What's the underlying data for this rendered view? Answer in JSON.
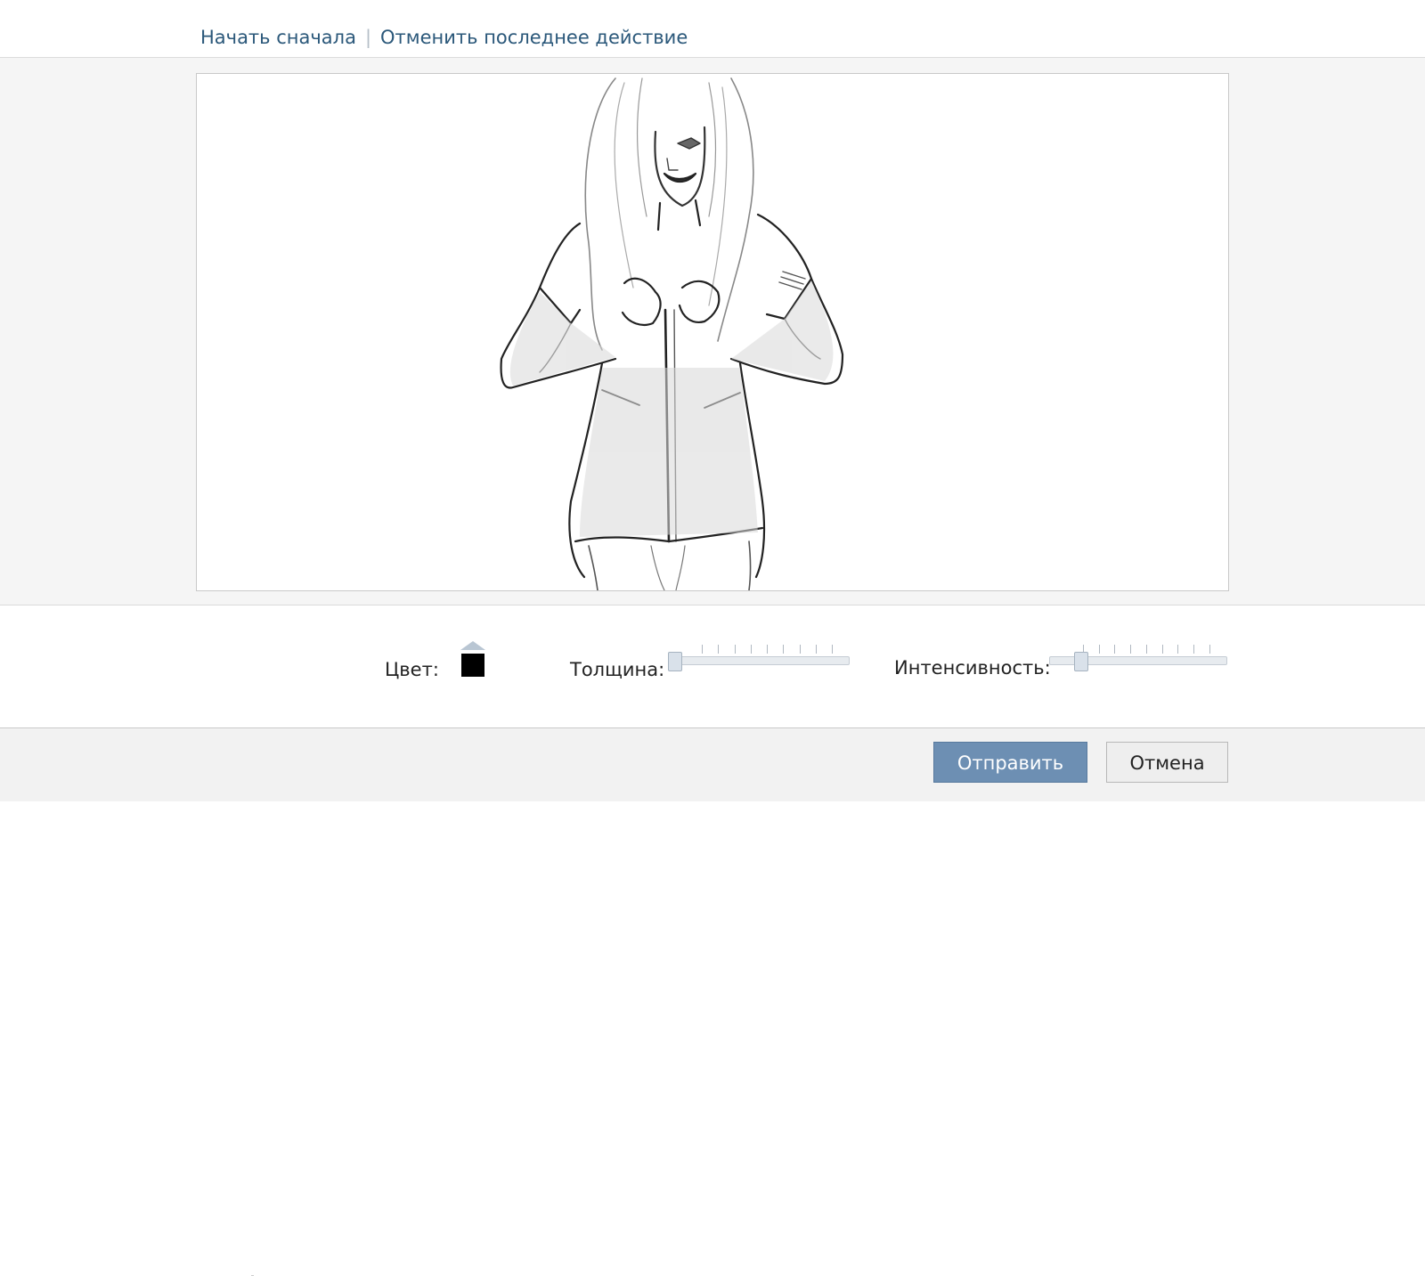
{
  "header": {
    "restart_link": "Начать сначала",
    "undo_link": "Отменить последнее действие"
  },
  "canvas": {
    "subject_icon": "sketch-drawing"
  },
  "toolbar": {
    "color_label": "Цвет:",
    "current_color": "#000000",
    "thickness_label": "Толщина:",
    "thickness_value": 0.0,
    "intensity_label": "Интенсивность:",
    "intensity_value": 0.15
  },
  "footer": {
    "send_label": "Отправить",
    "cancel_label": "Отмена"
  },
  "colors": {
    "link": "#2b587a",
    "primary_button": "#6d8fb3"
  }
}
